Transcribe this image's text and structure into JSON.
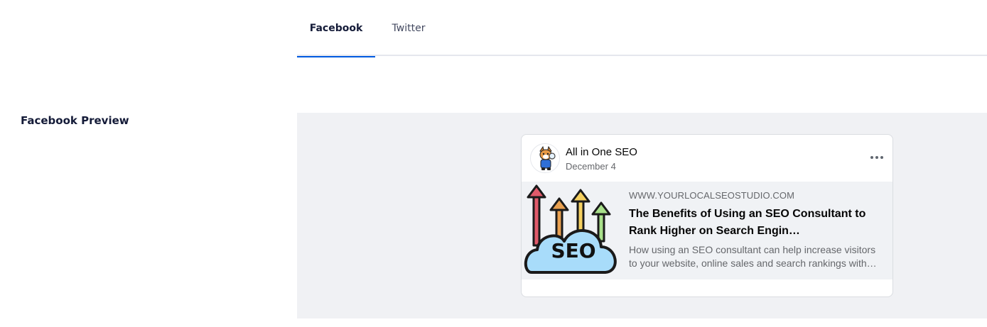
{
  "tabs": [
    {
      "label": "Facebook",
      "active": true
    },
    {
      "label": "Twitter",
      "active": false
    }
  ],
  "section": {
    "label": "Facebook Preview"
  },
  "post": {
    "page_name": "All in One SEO",
    "date": "December 4",
    "more_icon": "more-horizontal-icon",
    "link": {
      "domain": "WWW.YOURLOCALSEOSTUDIO.COM",
      "title_line1": "The Benefits of Using an SEO Consultant to",
      "title_line2": "Rank Higher on Search Engin…",
      "desc_line1": "How using an SEO consultant can help increase visitors",
      "desc_line2": "to your website, online sales and search rankings with…",
      "image_label": "SEO"
    }
  },
  "colors": {
    "tab_active_underline": "#005ae0",
    "preview_background": "#f0f1f4",
    "link_box_background": "#f0f2f5",
    "cloud_fill": "#a8dcfa",
    "arrow_colors": [
      "#e05a6a",
      "#e8a050",
      "#f5d060",
      "#a8e08a"
    ]
  }
}
